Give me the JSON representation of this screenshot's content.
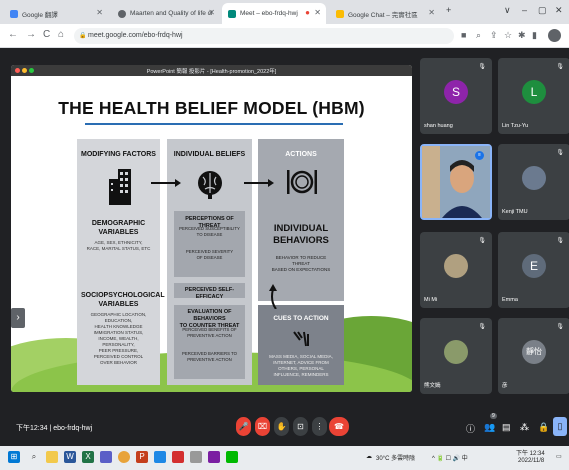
{
  "browser": {
    "tabs": [
      {
        "label": "Google 翻譯",
        "color": "#4285f4",
        "active": false
      },
      {
        "label": "Maarten and Quality of life cl",
        "color": "#5f6368",
        "active": false
      },
      {
        "label": "Meet – ebo-frdq-hwj",
        "color": "#00897b",
        "active": true
      },
      {
        "label": "",
        "color": "#ea4335",
        "active": false
      },
      {
        "label": "Google Chat – 完實社區",
        "color": "#fbbc04",
        "active": false
      }
    ],
    "new_tab": "+",
    "url": "meet.google.com/ebo-frdq-hwj",
    "window_controls": [
      "∨",
      "–",
      "▢",
      "✕"
    ]
  },
  "slide_window": {
    "title": "PowerPoint 簡報 投影片 - [Health-promotion_2022年]",
    "slide": {
      "title": "THE HEALTH BELIEF MODEL (HBM)",
      "col1": {
        "header": "MODIFYING FACTORS",
        "demographic_title": "DEMOGRAPHIC\nVARIABLES",
        "demographic_text": "AGE, SEX, ETHNICITY,\nRACE, MARITAL STATUS, ETC",
        "socio_title": "SOCIOPSYCHOLOGICAL\nVARIABLES",
        "socio_text": "GEOGRAPHIC LOCATION,\nEDUCATION,\nHEALTH KNOWLEDGE\nIMMIGRATION STATUS,\nINCOME, WEALTH,\nPERSONALITY,\nPEER PRESSURE,\nPERCEIVED CONTROL\nOVER BEHAVIOR"
      },
      "col2": {
        "header": "INDIVIDUAL BELIEFS",
        "threat_title": "PERCEPTIONS OF THREAT",
        "threat_text1": "PERCEIVED SUSCEPTIBILITY\nTO DISEASE",
        "threat_text2": "PERCEIVED SEVERITY\nOF DISEASE",
        "efficacy_title": "PERCEIVED SELF-EFFICACY",
        "eval_title": "EVALUATION OF BEHAVIORS\nTO COUNTER THREAT",
        "eval_text1": "PERCEIVED BENEFITS OF\nPREVENTIVE ACTION",
        "eval_text2": "PERCEIVED BARRIERS TO\nPREVENTIVE ACTION"
      },
      "col3": {
        "header": "ACTIONS",
        "behaviors_title": "INDIVIDUAL\nBEHAVIORS",
        "behaviors_text": "BEHAVIOR TO REDUCE THREAT\nBASED ON EXPECTATIONS",
        "cues_title": "CUES TO ACTION",
        "cues_text": "MASS MEDIA, SOCIAL MEDIA,\nINTERNET, ADVICE FROM\nOTHERS, PERSONAL\nINFLUENCE, REMINDERS"
      }
    }
  },
  "participants": [
    {
      "name": "shan huang",
      "initial": "S",
      "color": "#8e24aa"
    },
    {
      "name": "Lin Tzu-Yu",
      "initial": "L",
      "color": "#1e8e3e"
    },
    {
      "name": "Kenji TMU",
      "initial": "",
      "color": "#6b7a8f"
    },
    {
      "name": "Mi Mi",
      "initial": "",
      "color": "#b0a080"
    },
    {
      "name": "Emma",
      "initial": "E",
      "color": "#5f6b7a"
    },
    {
      "name": "熊文嫣",
      "initial": "",
      "color": "#8a9a6a"
    },
    {
      "name": "彦",
      "initial": "靜怡",
      "color": "#7a8088"
    }
  ],
  "controls": {
    "time": "下午12:34",
    "meeting_code": "ebo-frdq-hwj",
    "participant_count": "9"
  },
  "taskbar": {
    "weather": "30°C 多雲時陰",
    "time": "下午 12:34",
    "date": "2022/11/8"
  }
}
